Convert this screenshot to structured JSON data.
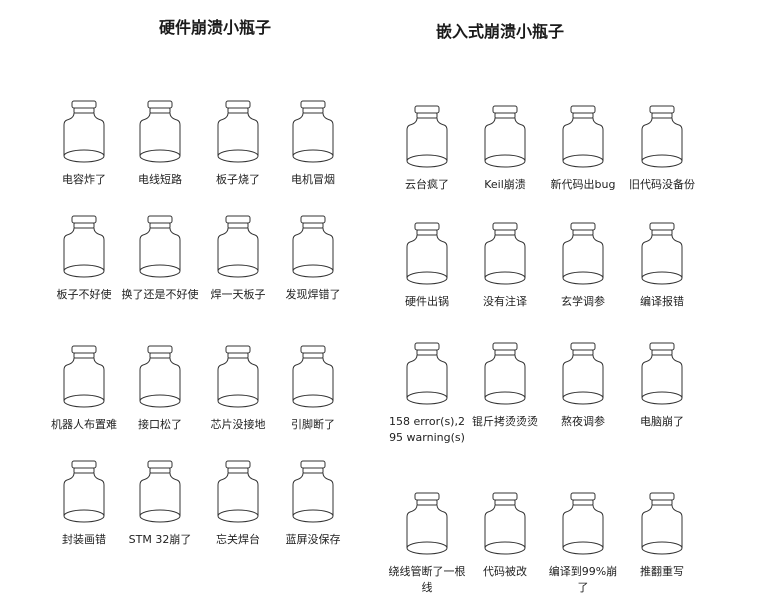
{
  "titles": {
    "left": "硬件崩溃小瓶子",
    "right": "嵌入式崩溃小瓶子"
  },
  "left_groups": [
    [
      "电容炸了",
      "电线短路",
      "板子烧了",
      "电机冒烟"
    ],
    [
      "板子不好使",
      "换了还是不好使",
      "焊一天板子",
      "发现焊错了"
    ],
    [
      "机器人布置难",
      "接口松了",
      "芯片没接地",
      "引脚断了"
    ],
    [
      "封装画错",
      "STM 32崩了",
      "忘关焊台",
      "蓝屏没保存"
    ]
  ],
  "right_groups": [
    [
      "云台疯了",
      "Keil崩溃",
      "新代码出bug",
      "旧代码没备份"
    ],
    [
      "硬件出锅",
      "没有注译",
      "玄学调参",
      "编译报错"
    ],
    [
      "158 error(s),295 warning(s)",
      "锟斤拷烫烫烫",
      "熬夜调参",
      "电脑崩了"
    ],
    [
      "绕线管断了一根线",
      "代码被改",
      "编译到99%崩了",
      "推翻重写"
    ]
  ],
  "icon": "empty-jar-icon",
  "colors": {
    "stroke": "#333333",
    "background": "#ffffff"
  }
}
